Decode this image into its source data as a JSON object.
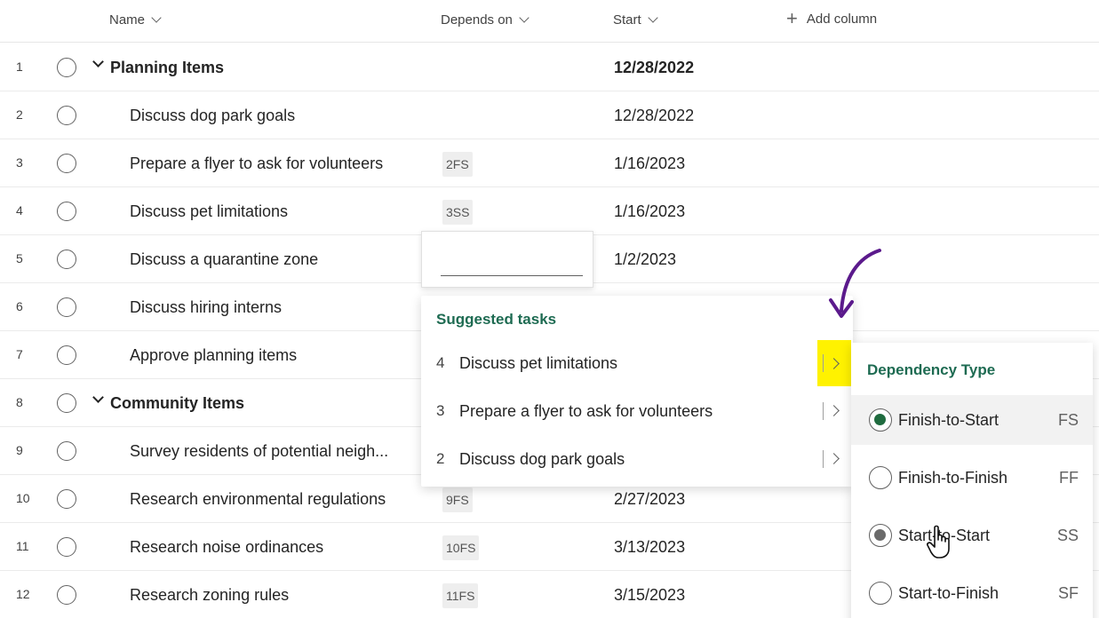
{
  "header": {
    "columns": [
      {
        "label": "Name"
      },
      {
        "label": "Depends on"
      },
      {
        "label": "Start"
      }
    ],
    "add_column_label": "Add column",
    "add_icon": "plus-icon",
    "sort_icon": "chevron-down-icon"
  },
  "rows": [
    {
      "num": "1",
      "name": "Planning Items",
      "group": true,
      "depends": "",
      "start": "12/28/2022"
    },
    {
      "num": "2",
      "name": "Discuss dog park goals",
      "group": false,
      "depends": "",
      "start": "12/28/2022"
    },
    {
      "num": "3",
      "name": "Prepare a flyer to ask for volunteers",
      "group": false,
      "depends": "2FS",
      "start": "1/16/2023"
    },
    {
      "num": "4",
      "name": "Discuss pet limitations",
      "group": false,
      "depends": "3SS",
      "start": "1/16/2023"
    },
    {
      "num": "5",
      "name": "Discuss a quarantine zone",
      "group": false,
      "depends": "",
      "start": "1/2/2023"
    },
    {
      "num": "6",
      "name": "Discuss hiring interns",
      "group": false,
      "depends": "",
      "start": ""
    },
    {
      "num": "7",
      "name": "Approve planning items",
      "group": false,
      "depends": "",
      "start": ""
    },
    {
      "num": "8",
      "name": "Community Items",
      "group": true,
      "depends": "",
      "start": ""
    },
    {
      "num": "9",
      "name": "Survey residents of potential neigh...",
      "group": false,
      "depends": "",
      "start": ""
    },
    {
      "num": "10",
      "name": "Research environmental regulations",
      "group": false,
      "depends": "9FS",
      "start": "2/27/2023"
    },
    {
      "num": "11",
      "name": "Research noise ordinances",
      "group": false,
      "depends": "10FS",
      "start": "3/13/2023"
    },
    {
      "num": "12",
      "name": "Research zoning rules",
      "group": false,
      "depends": "11FS",
      "start": "3/15/2023"
    }
  ],
  "depends_editor": {
    "value": ""
  },
  "suggested": {
    "title": "Suggested tasks",
    "items": [
      {
        "num": "4",
        "name": "Discuss pet limitations",
        "highlighted": true
      },
      {
        "num": "3",
        "name": "Prepare a flyer to ask for volunteers",
        "highlighted": false
      },
      {
        "num": "2",
        "name": "Discuss dog park goals",
        "highlighted": false
      }
    ]
  },
  "dependency_type": {
    "title": "Dependency Type",
    "options": [
      {
        "label": "Finish-to-Start",
        "abbr": "FS",
        "state": "selected"
      },
      {
        "label": "Finish-to-Finish",
        "abbr": "FF",
        "state": "none"
      },
      {
        "label": "Start-to-Start",
        "abbr": "SS",
        "state": "hover"
      },
      {
        "label": "Start-to-Finish",
        "abbr": "SF",
        "state": "none"
      }
    ]
  },
  "colors": {
    "accent_green": "#1e6b52",
    "highlight_yellow": "#fff200",
    "annotation_purple": "#5b1a8c"
  }
}
